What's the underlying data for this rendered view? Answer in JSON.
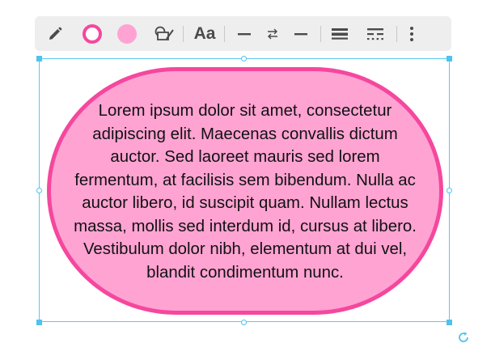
{
  "toolbar": {
    "items": [
      {
        "name": "pencil-icon",
        "kind": "icon"
      },
      {
        "name": "stroke-color-swatch",
        "kind": "swatch",
        "color": "#f5479e"
      },
      {
        "name": "fill-color-swatch",
        "kind": "swatch",
        "color": "#ffa3d3"
      },
      {
        "name": "shape-style-icon",
        "kind": "icon"
      },
      {
        "name": "font-button",
        "kind": "text",
        "label": "Aa"
      },
      {
        "name": "line-start-icon",
        "kind": "icon"
      },
      {
        "name": "swap-arrows-icon",
        "kind": "icon"
      },
      {
        "name": "line-end-icon",
        "kind": "icon"
      },
      {
        "name": "line-weight-icon",
        "kind": "icon"
      },
      {
        "name": "line-style-icon",
        "kind": "icon"
      },
      {
        "name": "more-options-icon",
        "kind": "icon"
      }
    ],
    "font_label": "Aa"
  },
  "shape": {
    "text": "Lorem ipsum dolor sit amet, consectetur adipiscing elit. Maecenas convallis dictum auctor. Sed laoreet mauris sed lorem fermentum, at facilisis sem bibendum. Nulla ac auctor libero, id suscipit quam. Nullam lectus massa, mollis sed interdum id, cursus at libero. Vestibulum dolor nibh, elementum at dui vel, blandit condimentum nunc.",
    "fill_color": "#ffa3d3",
    "stroke_color": "#f5479e"
  },
  "selection": {
    "color": "#4dc3ee"
  }
}
